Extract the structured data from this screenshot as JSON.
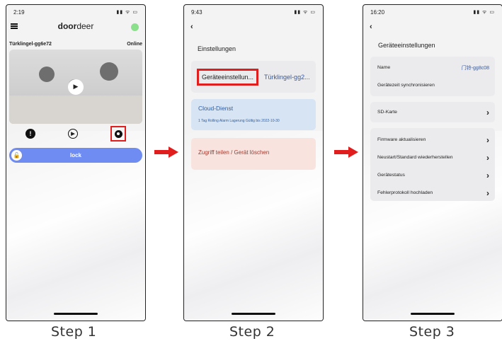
{
  "phone1": {
    "time": "2:19",
    "status_icons": "▮▮ ᯤ ▭",
    "logo_bold": "door",
    "logo_light": "deer",
    "device_name": "Türklingel-gg6e72",
    "device_status": "Online",
    "lock_label": "lock",
    "icons": [
      "alert-icon",
      "playback-icon",
      "settings-gear-icon",
      "unlock-icon",
      "play-icon",
      "hamburger-menu-icon"
    ]
  },
  "phone2": {
    "time": "9:43",
    "status_icons": "▮▮ ᯤ ▭",
    "back": "‹",
    "title": "Einstellungen",
    "settings_label": "Geräteeinstellun...",
    "device_name": "Türklingel-gg2...",
    "cloud_title": "Cloud-Dienst",
    "cloud_sub": "1 Tag Rolling Alarm Lagerung Gültig bis 2022-10-30",
    "share_label": "Zugriff teilen / Gerät löschen"
  },
  "phone3": {
    "time": "16:20",
    "status_icons": "▮▮ ᯤ ▭",
    "back": "‹",
    "title": "Geräteeinstellungen",
    "name_label": "Name",
    "name_value": "门铃-gg8c08",
    "sync_label": "Gerätezeit synchronisieren",
    "sd_label": "SD-Karte",
    "firmware_label": "Firmware aktualisieren",
    "restart_label": "Neustart/Standard wiederherstellen",
    "status_label": "Gerätestatus",
    "log_label": "Fehlerprotokoll hochladen",
    "chevron": "›"
  },
  "steps": [
    "Step 1",
    "Step 2",
    "Step 3"
  ],
  "colors": {
    "highlight": "#e01e1e",
    "accent_blue": "#6f8cf2",
    "online_green": "#8be08b"
  }
}
